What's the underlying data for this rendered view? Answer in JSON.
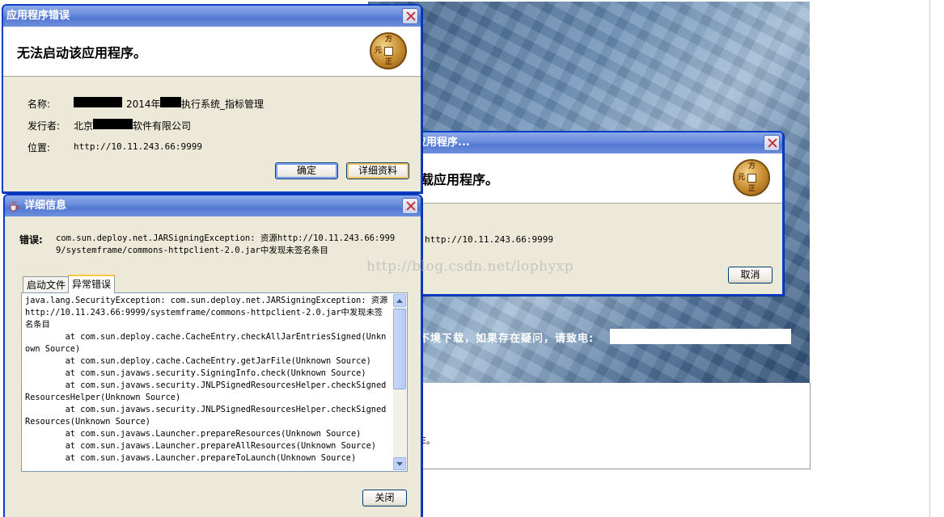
{
  "background": {
    "contact_text": "不境下载，如果存在疑问，请致电:",
    "tail_text": "E。",
    "watermark": "http://blog.csdn.net/lophyxp"
  },
  "error_dialog": {
    "title": "应用程序错误",
    "heading": "无法启动该应用程序。",
    "name_label": "名称:",
    "name_value_mid": "2014年",
    "name_value_suffix": "执行系统_指标管理",
    "publisher_label": "发行者:",
    "publisher_prefix": "北京",
    "publisher_suffix": "软件有限公司",
    "location_label": "位置:",
    "location_value": "http://10.11.243.66:9999",
    "ok_button": "确定",
    "details_button": "详细资料"
  },
  "loading_dialog": {
    "title_visible": "应用程序...",
    "heading_visible": "载应用程序。",
    "location_value": "http://10.11.243.66:9999",
    "cancel_button": "取消"
  },
  "details_dialog": {
    "title": "详细信息",
    "error_label": "错误:",
    "error_message": "com.sun.deploy.net.JARSigningException: 资源http://10.11.243.66:9999/systemframe/commons-httpclient-2.0.jar中发现未签名条目",
    "tabs": [
      {
        "label": "启动文件",
        "active": false
      },
      {
        "label": "异常错误",
        "active": true
      }
    ],
    "stack_trace": [
      "java.lang.SecurityException: com.sun.deploy.net.JARSigningException: 资源http://10.11.243.66:9999/systemframe/commons-httpclient-2.0.jar中发现未签名条目",
      "        at com.sun.deploy.cache.CacheEntry.checkAllJarEntriesSigned(Unknown Source)",
      "        at com.sun.deploy.cache.CacheEntry.getJarFile(Unknown Source)",
      "        at com.sun.javaws.security.SigningInfo.check(Unknown Source)",
      "        at com.sun.javaws.security.JNLPSignedResourcesHelper.checkSignedResourcesHelper(Unknown Source)",
      "        at com.sun.javaws.security.JNLPSignedResourcesHelper.checkSignedResources(Unknown Source)",
      "        at com.sun.javaws.Launcher.prepareResources(Unknown Source)",
      "        at com.sun.javaws.Launcher.prepareAllResources(Unknown Source)",
      "        at com.sun.javaws.Launcher.prepareToLaunch(Unknown Source)"
    ],
    "close_button": "关闭"
  },
  "icons": {
    "coin_logo": "coin-logo-icon",
    "close": "close-icon",
    "java": "java-cup-icon"
  },
  "colors": {
    "titlebar": "#6d8fdc",
    "window_border": "#0a3ec6",
    "dialog_bg": "#ece9d8"
  }
}
